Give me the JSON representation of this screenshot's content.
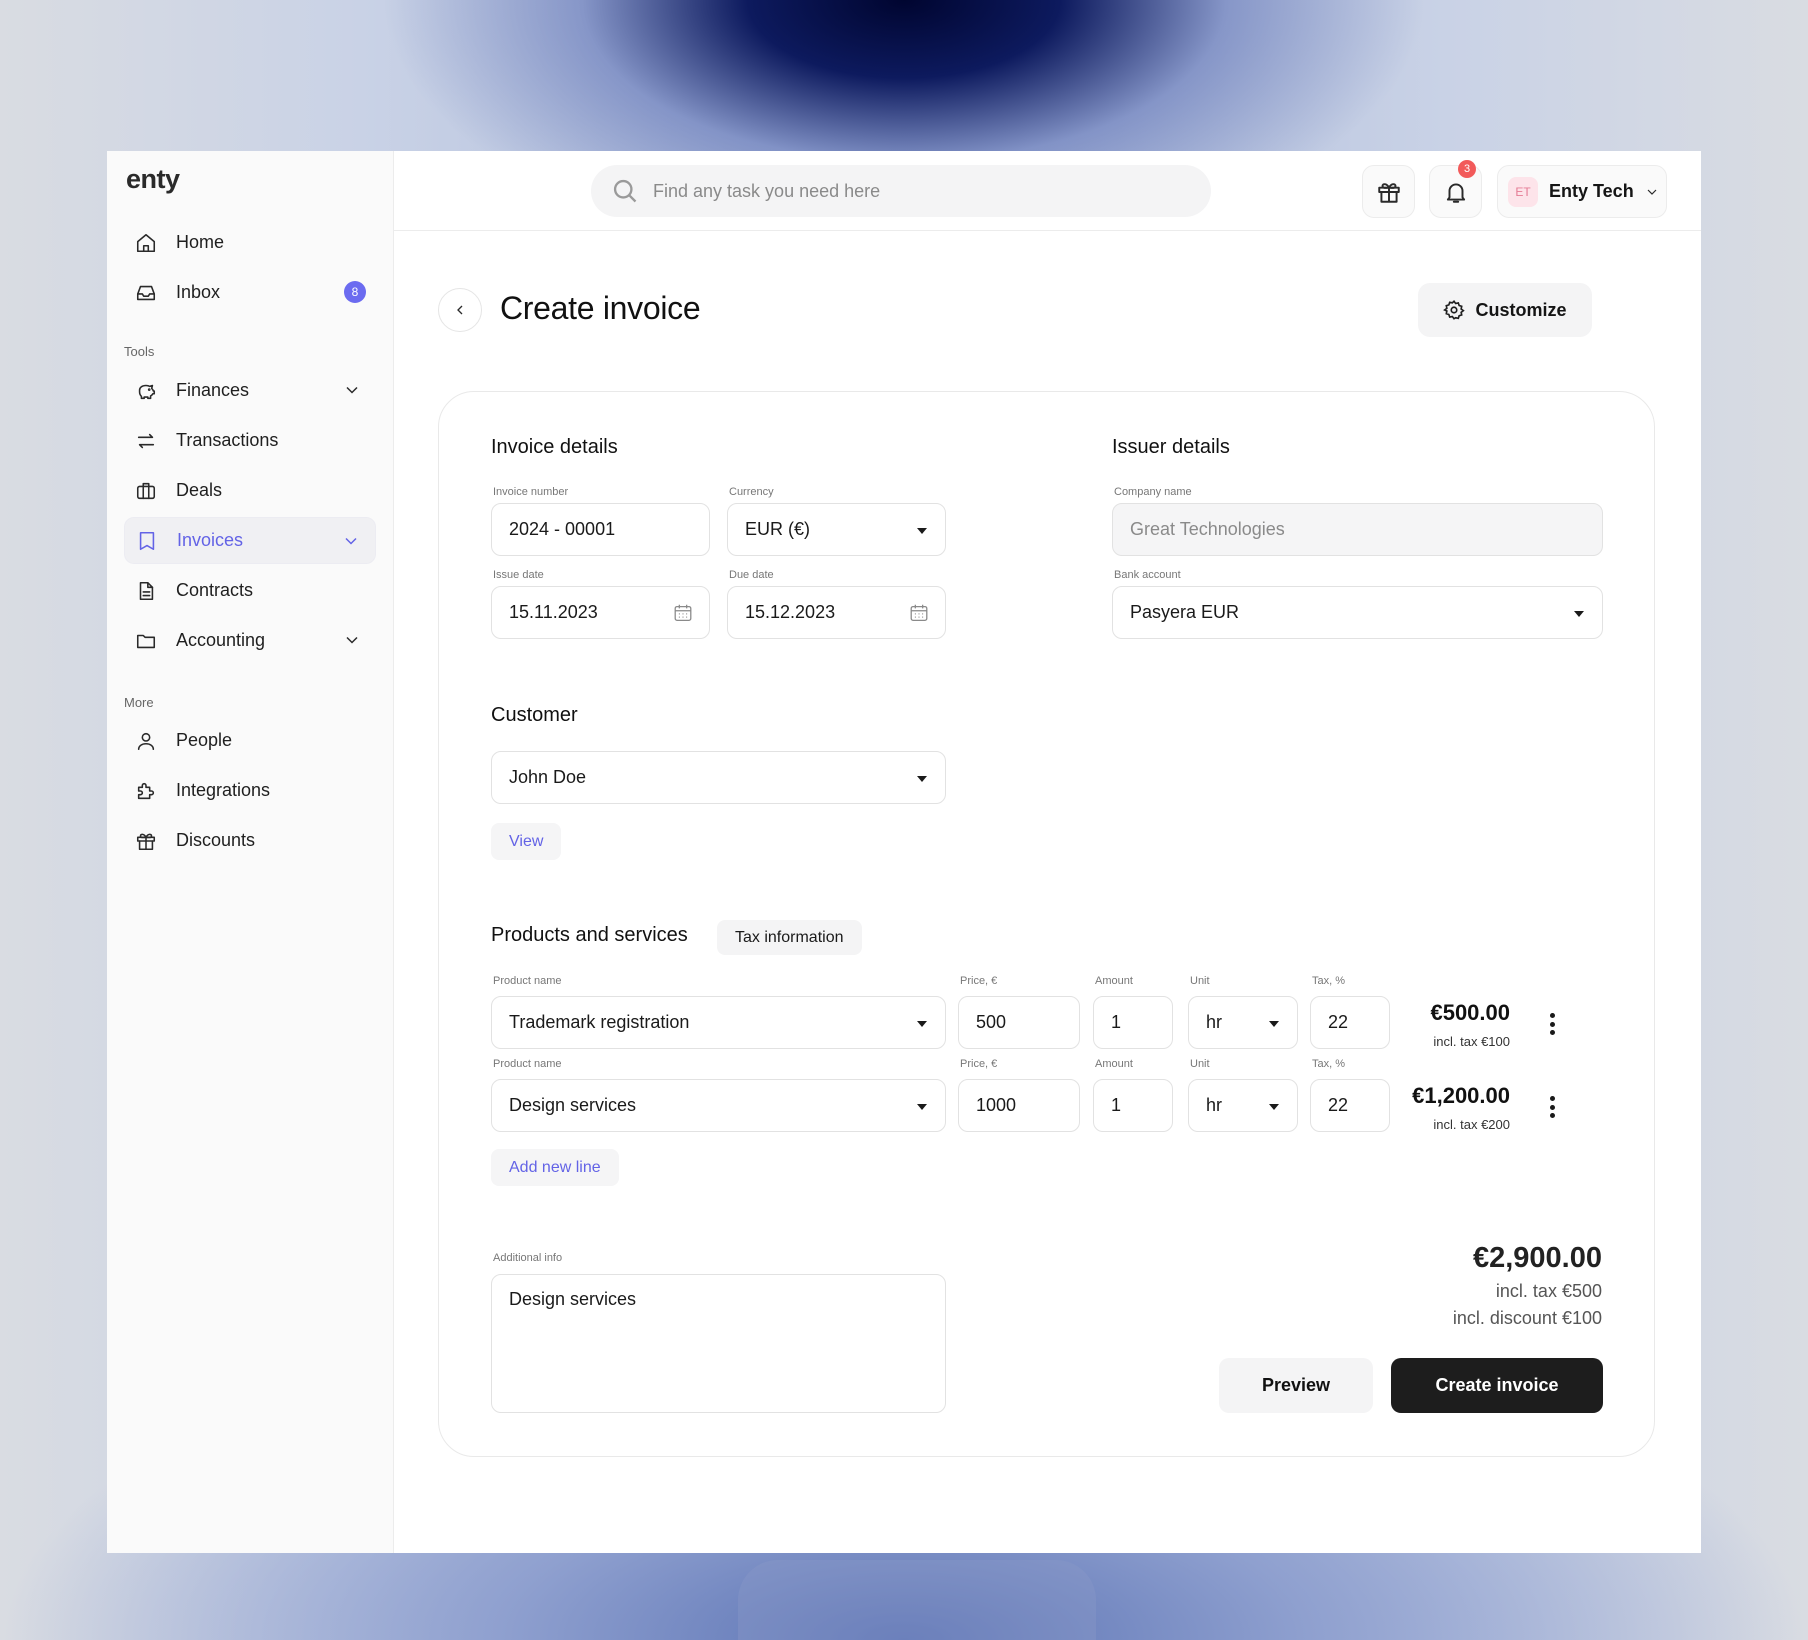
{
  "app": {
    "logo": "enty"
  },
  "sidebar": {
    "items": [
      {
        "label": "Home"
      },
      {
        "label": "Inbox",
        "badge": "8"
      },
      {
        "label": "Finances"
      },
      {
        "label": "Transactions"
      },
      {
        "label": "Deals"
      },
      {
        "label": "Invoices"
      },
      {
        "label": "Contracts"
      },
      {
        "label": "Accounting"
      },
      {
        "label": "People"
      },
      {
        "label": "Integrations"
      },
      {
        "label": "Discounts"
      }
    ],
    "sections": {
      "tools": "Tools",
      "more": "More"
    },
    "active": "Invoices"
  },
  "header": {
    "search_placeholder": "Find any task you need here",
    "notification_count": "3",
    "account": {
      "initials": "ET",
      "name": "Enty Tech"
    }
  },
  "page": {
    "title": "Create invoice",
    "customize_label": "Customize"
  },
  "invoice_details": {
    "title": "Invoice details",
    "invoice_number": {
      "label": "Invoice number",
      "value": "2024 - 00001"
    },
    "currency": {
      "label": "Currency",
      "value": "EUR (€)"
    },
    "issue_date": {
      "label": "Issue date",
      "value": "15.11.2023"
    },
    "due_date": {
      "label": "Due date",
      "value": "15.12.2023"
    }
  },
  "issuer_details": {
    "title": "Issuer details",
    "company_name": {
      "label": "Company name",
      "value": "Great Technologies"
    },
    "bank_account": {
      "label": "Bank account",
      "value": "Pasyera EUR"
    }
  },
  "customer": {
    "title": "Customer",
    "value": "John Doe",
    "view_label": "View"
  },
  "products": {
    "title": "Products and services",
    "tax_info_label": "Tax information",
    "col_labels": {
      "product": "Product name",
      "price": "Price, €",
      "amount": "Amount",
      "unit": "Unit",
      "tax": "Tax, %"
    },
    "lines": [
      {
        "product": "Trademark registration",
        "price": "500",
        "amount": "1",
        "unit": "hr",
        "tax": "22",
        "total": "€500.00",
        "total_tax": "incl. tax €100"
      },
      {
        "product": "Design services",
        "price": "1000",
        "amount": "1",
        "unit": "hr",
        "tax": "22",
        "total": "€1,200.00",
        "total_tax": "incl. tax €200"
      }
    ],
    "add_line_label": "Add new line"
  },
  "additional_info": {
    "label": "Additional info",
    "value": "Design services"
  },
  "summary": {
    "total": "€2,900.00",
    "tax": "incl. tax €500",
    "discount": "incl. discount €100"
  },
  "actions": {
    "preview": "Preview",
    "create": "Create invoice"
  },
  "colors": {
    "accent": "#6363e6",
    "primary_button": "#1d1d1d",
    "notification": "#f25a5a"
  }
}
